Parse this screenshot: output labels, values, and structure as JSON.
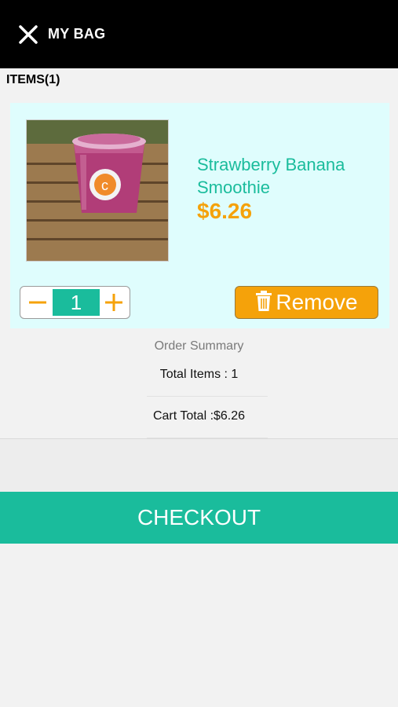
{
  "header": {
    "title": "MY BAG",
    "close_icon": "close-icon"
  },
  "items_heading": "ITEMS(1)",
  "cart_items": [
    {
      "name": "Strawberry Banana Smoothie",
      "price": "$6.26",
      "quantity": "1",
      "image": "smoothie-cup-photo",
      "remove_label": "Remove",
      "remove_icon": "trash-icon"
    }
  ],
  "summary": {
    "title": "Order Summary",
    "total_items": "Total Items : 1",
    "cart_total": "Cart Total :$6.26"
  },
  "checkout_label": "CHECKOUT",
  "colors": {
    "accent_teal": "#1abc9c",
    "accent_orange": "#f5a20a",
    "card_bg": "#dffdfd",
    "header_bg": "#000000"
  }
}
